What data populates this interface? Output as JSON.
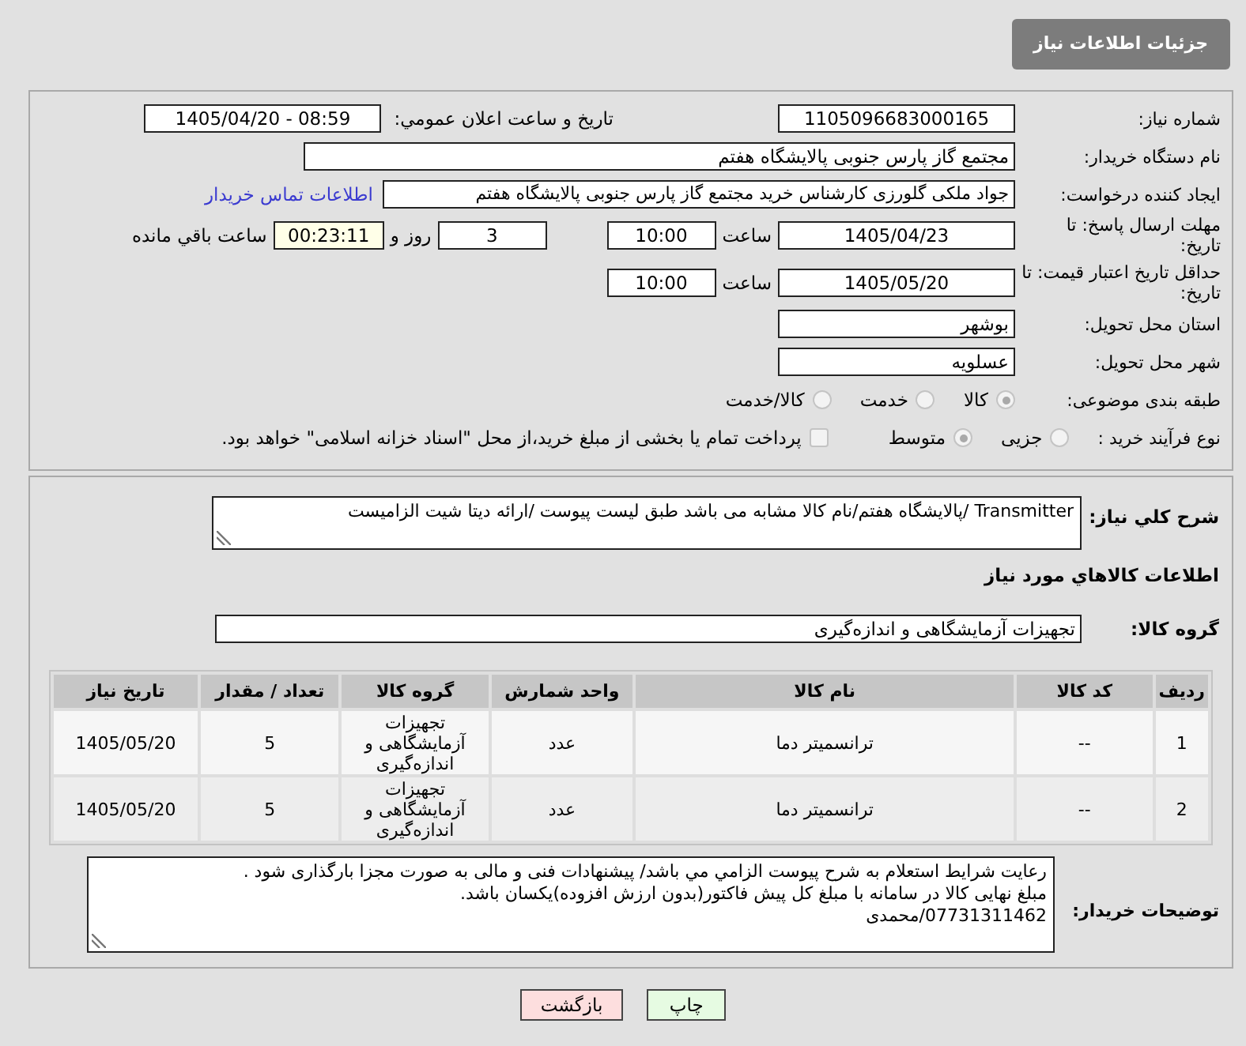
{
  "header": {
    "title": "جزئیات اطلاعات نیاز"
  },
  "summary": {
    "rows": [
      {
        "label": "شماره نیاز:",
        "items": [
          {
            "kind": "number_field",
            "value": "1105096683000165"
          },
          {
            "kind": "side_label",
            "text": "تاریخ و ساعت اعلان عمومي:"
          },
          {
            "kind": "number_field",
            "value": "1405/04/20 - 08:59"
          }
        ]
      },
      {
        "label": "نام دستگاه خریدار:",
        "items": [
          {
            "kind": "text_field",
            "value": "مجتمع گاز پارس جنوبی  پالایشگاه هفتم"
          }
        ]
      },
      {
        "label": "ایجاد کننده درخواست:",
        "items": [
          {
            "kind": "text_field",
            "value": "جواد ملکی گلورزی کارشناس خرید مجتمع گاز پارس جنوبی  پالایشگاه هفتم"
          },
          {
            "kind": "link",
            "text": "اطلاعات تماس خریدار"
          }
        ]
      },
      {
        "label": "مهلت ارسال پاسخ: تا تاریخ:",
        "items": [
          {
            "kind": "number_field",
            "value": "1405/04/23"
          },
          {
            "kind": "text",
            "text": "ساعت"
          },
          {
            "kind": "time_field",
            "value": "10:00"
          },
          {
            "kind": "count_field",
            "value": "3"
          },
          {
            "kind": "text",
            "text": "روز و"
          },
          {
            "kind": "timer_field",
            "value": "00:23:11"
          },
          {
            "kind": "text",
            "text": "ساعت باقي مانده"
          }
        ]
      },
      {
        "label": "حداقل تاریخ اعتبار قیمت: تا تاریخ:",
        "items": [
          {
            "kind": "number_field",
            "value": "1405/05/20"
          },
          {
            "kind": "text",
            "text": "ساعت"
          },
          {
            "kind": "time_field",
            "value": "10:00"
          }
        ]
      },
      {
        "label": "استان محل تحویل:",
        "items": [
          {
            "kind": "text_field",
            "value": "بوشهر"
          }
        ]
      },
      {
        "label": "شهر محل تحویل:",
        "items": [
          {
            "kind": "text_field",
            "value": "عسلویه"
          }
        ]
      },
      {
        "label": "طبقه بندی موضوعی:",
        "items": [
          {
            "kind": "radio",
            "label": "کالا",
            "selected": true,
            "disabled": true
          },
          {
            "kind": "radio",
            "label": "خدمت",
            "selected": false,
            "disabled": true
          },
          {
            "kind": "radio",
            "label": "کالا/خدمت",
            "selected": false,
            "disabled": true
          }
        ]
      },
      {
        "label": "نوع فرآیند خرید :",
        "items": [
          {
            "kind": "radio",
            "label": "جزیی",
            "selected": false,
            "disabled": true
          },
          {
            "kind": "radio",
            "label": "متوسط",
            "selected": true,
            "disabled": true
          },
          {
            "kind": "checkbox",
            "label": "پرداخت تمام یا بخشی از مبلغ خرید،از محل \"اسناد خزانه اسلامی\" خواهد بود.",
            "checked": false,
            "disabled": true
          }
        ]
      }
    ]
  },
  "need_description": {
    "label": "شرح کلي نیاز:",
    "value": "Transmitter /پالایشگاه هفتم/نام کالا مشابه می باشد طبق لیست پیوست /ارائه دیتا شیت الزامیست"
  },
  "goods": {
    "title": "اطلاعات کالاهاي مورد نیاز",
    "group": {
      "label": "گروه کالا:",
      "value": "تجهیزات آزمایشگاهی و اندازه‌گیری"
    },
    "table": {
      "columns": [
        "ردیف",
        "کد کالا",
        "نام کالا",
        "واحد شمارش",
        "گروه کالا",
        "تعداد / مقدار",
        "تاریخ نیاز"
      ],
      "rows": [
        [
          "1",
          "--",
          "ترانسمیتر دما",
          "عدد",
          "تجهیزات آزمایشگاهی و اندازه‌گیری",
          "5",
          "1405/05/20"
        ],
        [
          "2",
          "--",
          "ترانسمیتر دما",
          "عدد",
          "تجهیزات آزمایشگاهی و اندازه‌گیری",
          "5",
          "1405/05/20"
        ]
      ]
    }
  },
  "buyer_notes": {
    "label": "توضیحات خریدار:",
    "value": "رعایت شرایط استعلام به شرح پیوست الزامي مي باشد/ پیشنهادات فنی و مالی به صورت مجزا بارگذاری شود .\nمبلغ نهایی کالا در سامانه با مبلغ کل پیش فاکتور(بدون ارزش افزوده)یکسان باشد.\n07731311462/محمدی"
  },
  "buttons": [
    {
      "kind": "print",
      "label": "چاپ"
    },
    {
      "kind": "back",
      "label": "بازگشت"
    }
  ]
}
